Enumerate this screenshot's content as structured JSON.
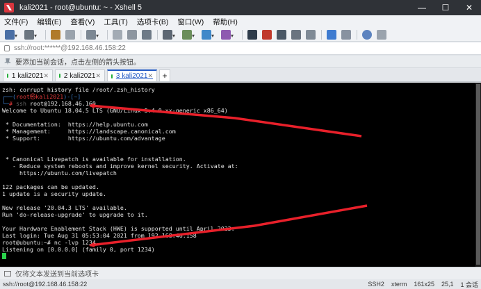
{
  "window": {
    "title": "kali2021 - root@ubuntu: ~ - Xshell 5"
  },
  "menu": [
    "文件(F)",
    "编辑(E)",
    "查看(V)",
    "工具(T)",
    "选项卡(B)",
    "窗口(W)",
    "帮助(H)"
  ],
  "address": "ssh://root:******@192.168.46.158:22",
  "infobar": "要添加当前会话，点击左侧的箭头按钮。",
  "tabs": [
    {
      "number": "1",
      "label": "kali2021",
      "active": false
    },
    {
      "number": "2",
      "label": "kali2021",
      "active": false
    },
    {
      "number": "3",
      "label": "kali2021",
      "active": true
    }
  ],
  "tab_add": "+",
  "terminal": {
    "lines": [
      "zsh: corrupt history file /root/.zsh_history",
      "",
      "",
      "Welcome to Ubuntu 18.04.5 LTS (GNU/Linux 5.4.0-xx-generic x86_64)",
      "",
      " * Documentation:  https://help.ubuntu.com",
      " * Management:     https://landscape.canonical.com",
      " * Support:        https://ubuntu.com/advantage",
      "",
      "",
      " * Canonical Livepatch is available for installation.",
      "   - Reduce system reboots and improve kernel security. Activate at:",
      "     https://ubuntu.com/livepatch",
      "",
      "122 packages can be updated.",
      "1 update is a security update.",
      "",
      "New release '20.04.3 LTS' available.",
      "Run 'do-release-upgrade' to upgrade to it.",
      "",
      "Your Hardware Enablement Stack (HWE) is supported until April 2023.",
      "Last login: Tue Aug 31 05:53:04 2021 from 192.168.46.158",
      "root@ubuntu:~# nc -lvp 1234",
      "Listening on [0.0.0.0] (family 0, port 1234)"
    ],
    "prompt_line1_prefix": "┌──(",
    "prompt_user": "root㉿kali2021",
    "prompt_line1_suffix": ")-[~]",
    "prompt_line2_prefix": "└─",
    "prompt_hash": "# ",
    "prompt_cmd_dim": "ssh ",
    "prompt_cmd": "root@192.168.46.160"
  },
  "sendbar": "仅将文本发送到当前选项卡",
  "status": {
    "left": "ssh://root@192.168.46.158:22",
    "protocol": "SSH2",
    "term": "xterm",
    "size": "161x25",
    "pos": "25,1",
    "sessions": "1 会话"
  },
  "colors": {
    "arrow": "#e8202a",
    "cursor": "#2ad14b",
    "titlebar": "#2f3237"
  }
}
